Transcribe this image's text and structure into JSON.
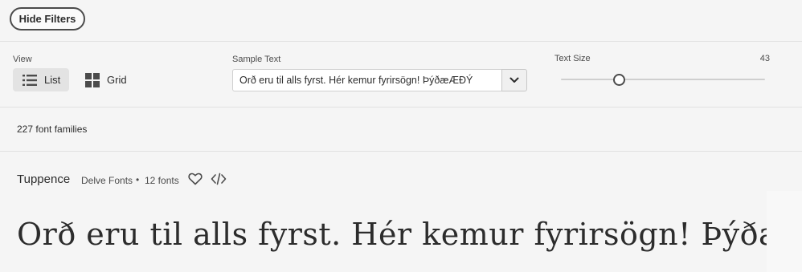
{
  "toolbar": {
    "hide_filters_label": "Hide Filters"
  },
  "filters": {
    "view": {
      "label": "View",
      "options": [
        {
          "label": "List",
          "icon": "list-icon",
          "selected": true
        },
        {
          "label": "Grid",
          "icon": "grid-icon",
          "selected": false
        }
      ]
    },
    "sample_text": {
      "label": "Sample Text",
      "value": "Orð eru til alls fyrst. Hér kemur fyrirsögn! ÞýðæÆÐÝ"
    },
    "text_size": {
      "label": "Text Size",
      "value": "43"
    }
  },
  "results": {
    "count_label": "227 font families"
  },
  "family": {
    "name": "Tuppence",
    "foundry": "Delve Fonts",
    "separator": "•",
    "font_count": "12 fonts",
    "preview_text": "Orð eru til alls fyrst. Hér kemur fyrirsögn! ÞýðæÆÐÝ"
  },
  "colors": {
    "text": "#2c2c2c",
    "border": "#4b4b4b",
    "background": "#f5f5f5"
  }
}
